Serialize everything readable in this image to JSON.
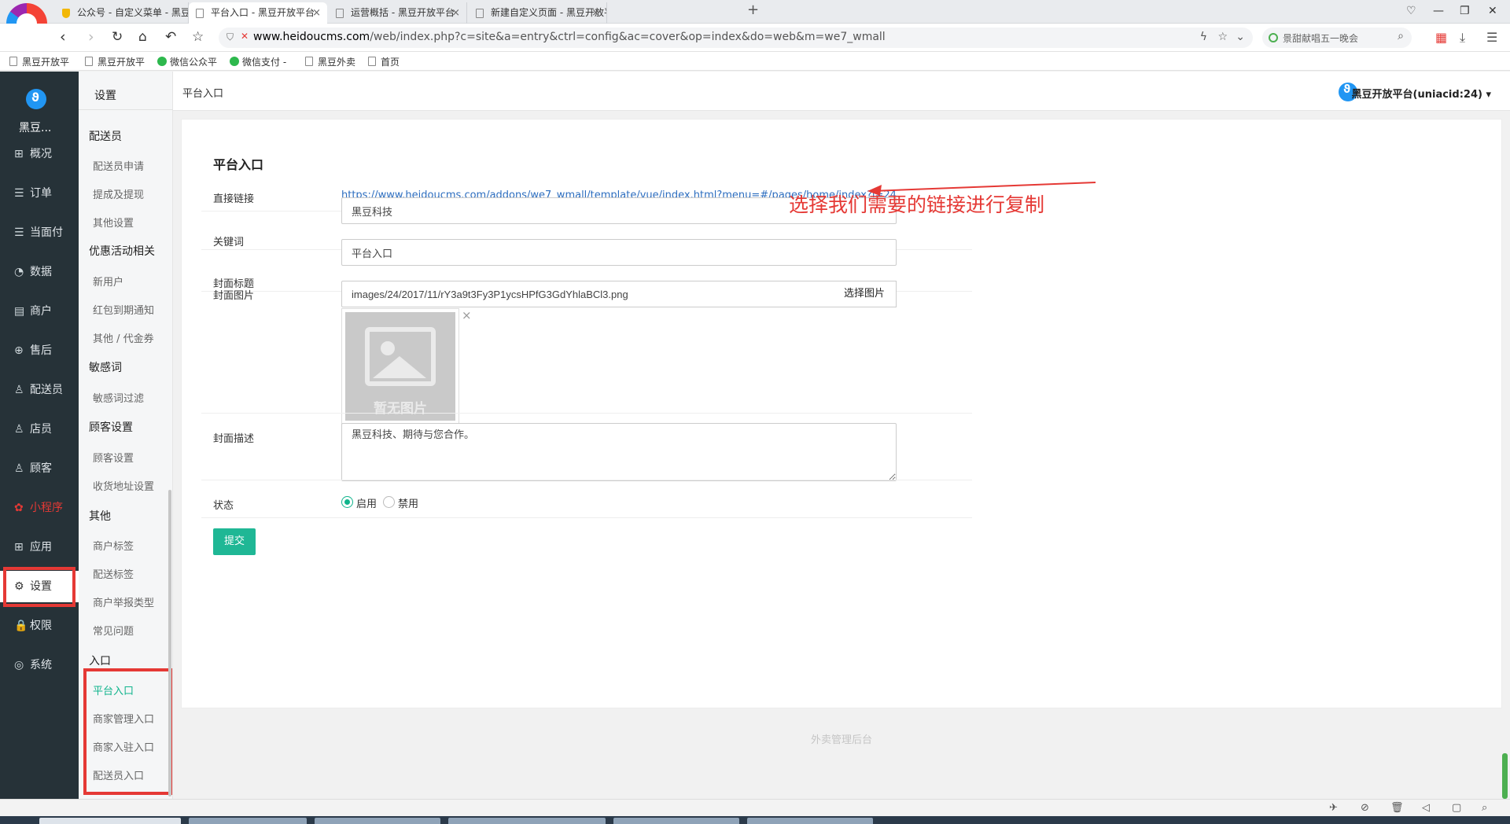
{
  "browser": {
    "tabs": [
      {
        "title": "公众号 - 自定义菜单 - 黑豆开放平台"
      },
      {
        "title": "平台入口 - 黑豆开放平台"
      },
      {
        "title": "运营概括 - 黑豆开放平台"
      },
      {
        "title": "新建自定义页面 - 黑豆开放平台"
      }
    ],
    "url_host": "www.heidoucms.com",
    "url_path": "/web/index.php?c=site&a=entry&ctrl=config&ac=cover&op=index&do=web&m=we7_wmall",
    "search_hint": "景甜献唱五一晚会",
    "bookmarks": [
      "黑豆开放平",
      "黑豆开放平",
      "微信公众平",
      "微信支付 -",
      "黑豆外卖",
      "首页"
    ]
  },
  "app": {
    "brand_name": "黑豆...",
    "nav": [
      {
        "label": "概况",
        "icon": "overview-icon",
        "glyph": "⊞"
      },
      {
        "label": "订单",
        "icon": "order-icon",
        "glyph": "☰"
      },
      {
        "label": "当面付",
        "icon": "pay-icon",
        "glyph": "☰"
      },
      {
        "label": "数据",
        "icon": "data-icon",
        "glyph": "◔"
      },
      {
        "label": "商户",
        "icon": "store-icon",
        "glyph": "▤"
      },
      {
        "label": "售后",
        "icon": "aftersale-icon",
        "glyph": "⊕"
      },
      {
        "label": "配送员",
        "icon": "courier-icon",
        "glyph": "♙"
      },
      {
        "label": "店员",
        "icon": "clerk-icon",
        "glyph": "♙"
      },
      {
        "label": "顾客",
        "icon": "customer-icon",
        "glyph": "♙"
      },
      {
        "label": "小程序",
        "icon": "miniprogram-icon",
        "glyph": "✿"
      },
      {
        "label": "应用",
        "icon": "apps-icon",
        "glyph": "⊞"
      },
      {
        "label": "设置",
        "icon": "gear-icon",
        "glyph": "⚙"
      },
      {
        "label": "权限",
        "icon": "lock-icon",
        "glyph": "🔒"
      },
      {
        "label": "系统",
        "icon": "system-icon",
        "glyph": "◎"
      }
    ],
    "sub_title": "设置",
    "sub_groups": [
      {
        "title": "配送员",
        "items": [
          "配送员申请",
          "提成及提现",
          "其他设置"
        ]
      },
      {
        "title": "优惠活动相关",
        "items": [
          "新用户",
          "红包到期通知",
          "其他 / 代金券"
        ]
      },
      {
        "title": "敏感词",
        "items": [
          "敏感词过滤"
        ]
      },
      {
        "title": "顾客设置",
        "items": [
          "顾客设置",
          "收货地址设置"
        ]
      },
      {
        "title": "其他",
        "items": [
          "商户标签",
          "配送标签",
          "商户举报类型",
          "常见问题"
        ]
      },
      {
        "title": "入口",
        "items": [
          "平台入口",
          "商家管理入口",
          "商家入驻入口",
          "配送员入口"
        ]
      }
    ],
    "breadcrumb": "平台入口",
    "user": "黑豆开放平台(uniacid:24)"
  },
  "form": {
    "title": "平台入口",
    "link_label": "直接链接",
    "link_value": "https://www.heidoucms.com/addons/we7_wmall/template/vue/index.html?menu=#/pages/home/index?i=24",
    "keyword_label": "关键词",
    "keyword_value": "黑豆科技",
    "cover_title_label": "封面标题",
    "cover_title_value": "平台入口",
    "cover_image_label": "封面图片",
    "cover_image_value": "images/24/2017/11/rY3a9t3Fy3P1ycsHPfG3GdYhlaBCl3.png",
    "choose_image": "选择图片",
    "no_image": "暂无图片",
    "desc_label": "封面描述",
    "desc_value": "黑豆科技、期待与您合作。",
    "status_label": "状态",
    "status_on": "启用",
    "status_off": "禁用",
    "submit": "提交"
  },
  "annotation": "选择我们需要的链接进行复制",
  "footer": "外卖管理后台",
  "colors": {
    "accent": "#1fb795",
    "highlight": "#e53935",
    "sidebar": "#263238",
    "link": "#2c6dbf"
  }
}
